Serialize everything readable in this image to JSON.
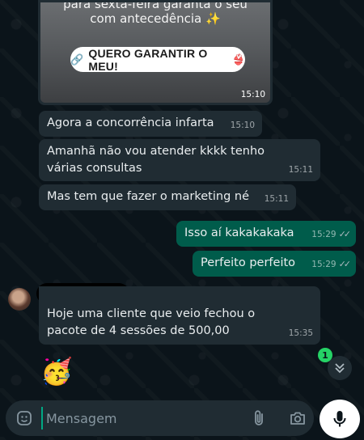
{
  "chat": {
    "image_message": {
      "caption_line1": "para sexta-feira garanta o seu",
      "caption_line2": "com antecedência ✨",
      "cta_icon": "🔗",
      "cta_label": "QUERO GARANTIR O MEU!",
      "cta_icon2": "👙",
      "time": "15:10"
    },
    "messages": [
      {
        "text": "Agora a concorrência infarta",
        "time": "15:10",
        "direction": "incoming"
      },
      {
        "text": "Amanhã não vou atender kkkk tenho várias consultas",
        "time": "15:11",
        "direction": "incoming"
      },
      {
        "text": "Mas tem que fazer o marketing né",
        "time": "15:11",
        "direction": "incoming"
      },
      {
        "text": "Isso aí kakakakaka",
        "time": "15:29",
        "direction": "outgoing",
        "status": "read"
      },
      {
        "text": "Perfeito perfeito",
        "time": "15:29",
        "direction": "outgoing",
        "status": "read"
      },
      {
        "text": "Hoje uma cliente que veio fechou o pacote de 4 sessões de 500,00",
        "time": "15:35",
        "direction": "incoming"
      }
    ],
    "ticks": "✓✓",
    "sticker_emoji": "🥳",
    "unread_count": "1",
    "scroll_icon": "chevrons-down-icon"
  },
  "composer": {
    "placeholder": "Mensagem",
    "emoji_icon": "sticker-icon",
    "attach_icon": "paperclip-icon",
    "camera_icon": "camera-icon",
    "mic_icon": "microphone-icon"
  },
  "colors": {
    "background": "#0b141a",
    "incoming_bubble": "#202c33",
    "outgoing_bubble": "#005c4b",
    "accent": "#00a884",
    "unread_badge": "#25d366"
  }
}
